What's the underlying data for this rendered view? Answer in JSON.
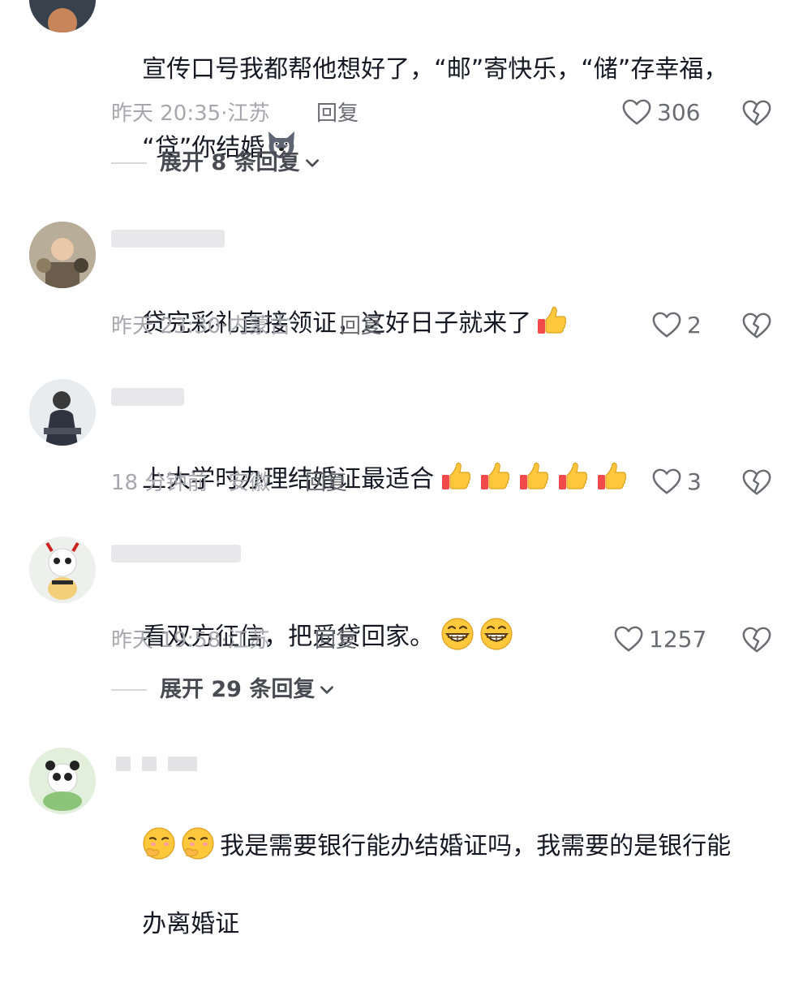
{
  "comments": [
    {
      "id": "c1",
      "text_line1": "宣传口号我都帮他想好了，“邮”寄快乐，“储”存幸福，",
      "text_line2": "“贷”你结婚",
      "time": "昨天 20:35",
      "location": "江苏",
      "reply_label": "回复",
      "likes": "306",
      "expand_label": "展开 8 条回复"
    },
    {
      "id": "c2",
      "text": "贷完彩礼直接领证，这好日子就来了",
      "time": "昨天 23:30",
      "location": "内蒙古",
      "reply_label": "回复",
      "likes": "2"
    },
    {
      "id": "c3",
      "text": "上大学时办理结婚证最适合",
      "time": "18 分钟前",
      "location": "安徽",
      "reply_label": "回复",
      "likes": "3"
    },
    {
      "id": "c4",
      "text": "看双方征信，把爱贷回家。",
      "time": "昨天 19:58",
      "location": "江苏",
      "reply_label": "回复",
      "likes": "1257",
      "expand_label": "展开 29 条回复"
    },
    {
      "id": "c5",
      "text_line1": "我是需要银行能办结婚证吗，我需要的是银行能",
      "text_line2": "办离婚证"
    }
  ],
  "icons": {
    "like": "heart-outline-icon",
    "dislike": "broken-heart-icon",
    "expand": "chevron-down-icon",
    "emoji_husky": "husky-emoji-icon",
    "emoji_thumb": "thumbs-up-emoji-icon",
    "emoji_grin": "grin-emoji-icon",
    "emoji_shush": "shush-emoji-icon"
  },
  "colors": {
    "text": "#161823",
    "meta": "#a7a7ad",
    "action": "#6b6b72",
    "thumb": "#ffc83d"
  }
}
